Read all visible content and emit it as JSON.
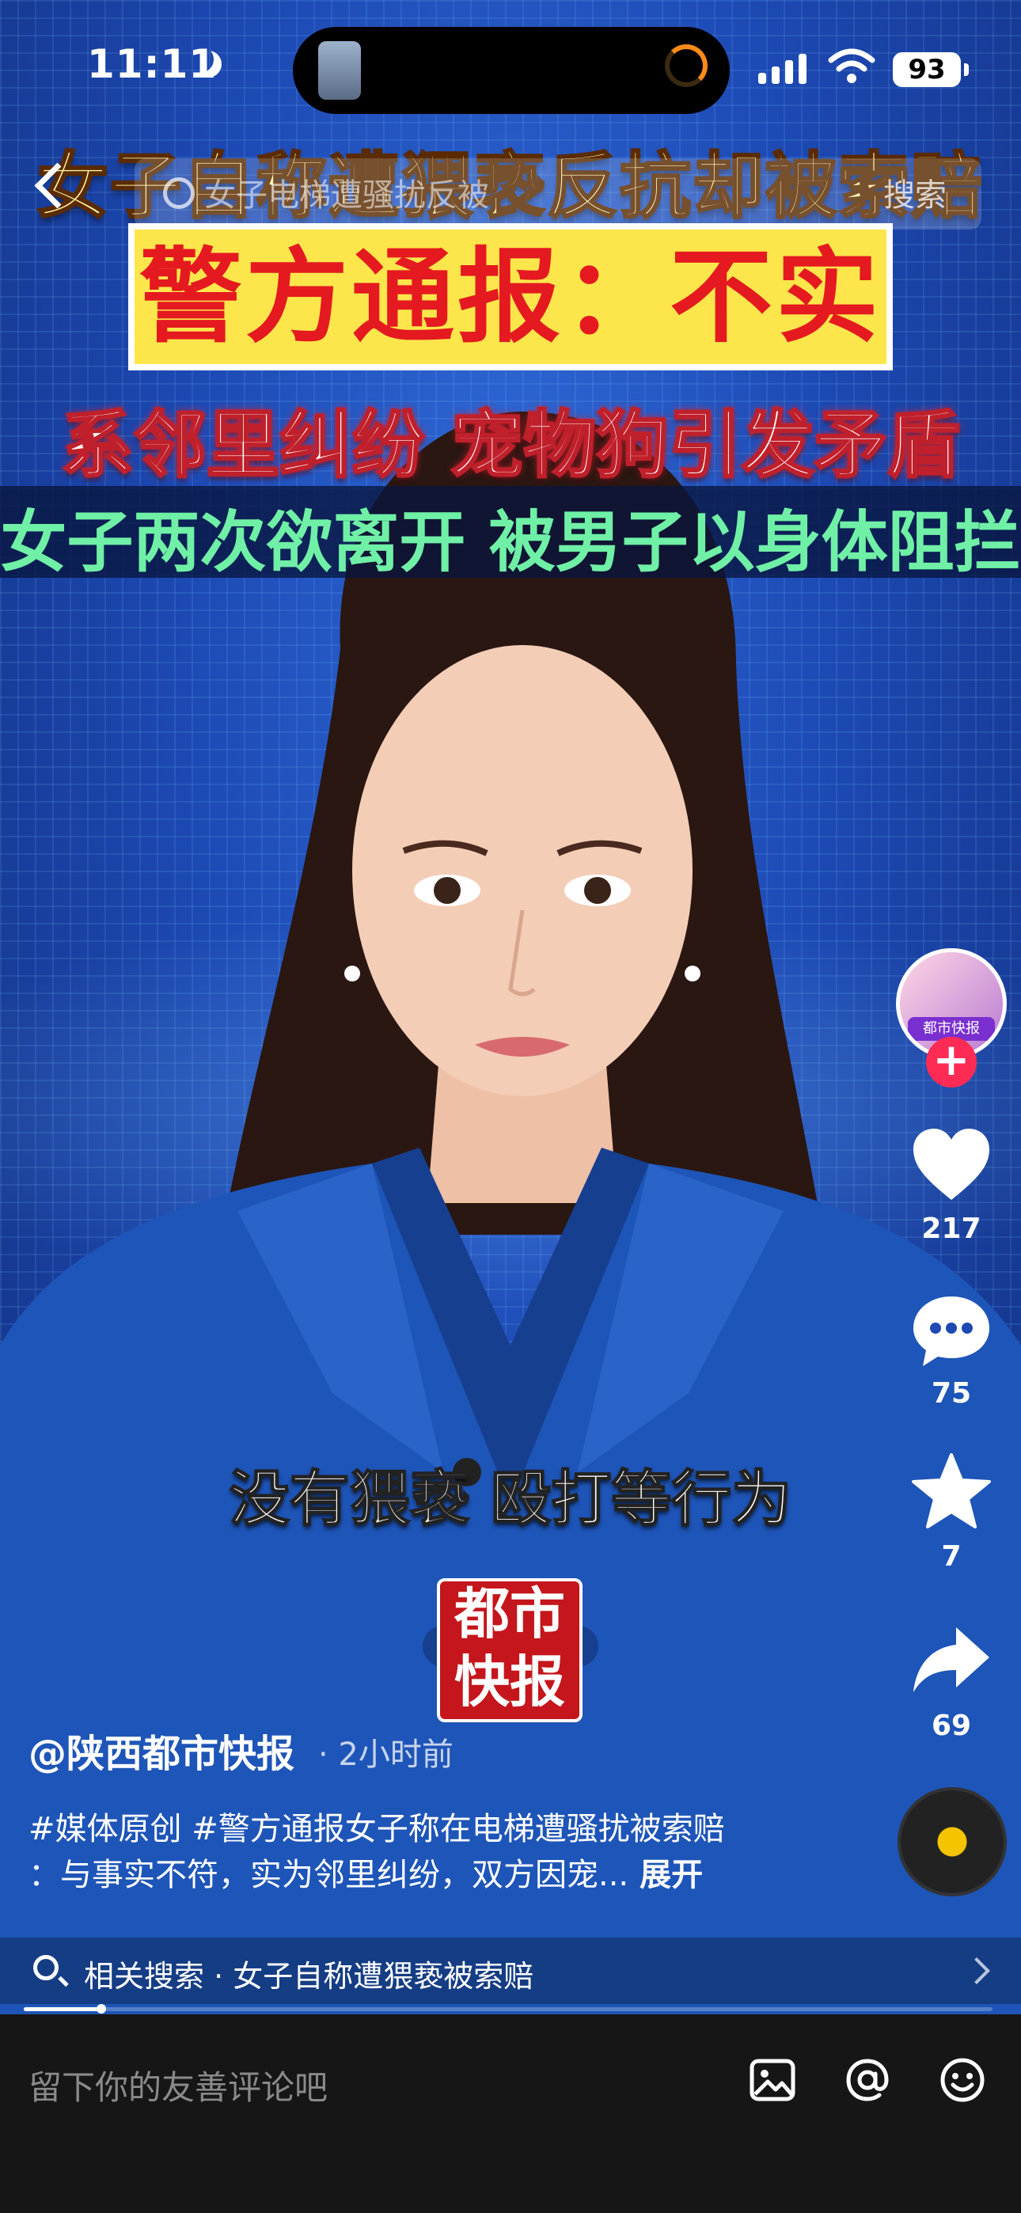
{
  "status_bar": {
    "time": "11:11",
    "battery": "93"
  },
  "top_search": {
    "placeholder": "女子电梯遭骚扰反被",
    "button": "搜索"
  },
  "overlay": {
    "headline_1": "女子自称遭猥亵反抗却被索赔",
    "headline_2": "警方通报：不实",
    "headline_3": "系邻里纠纷 宠物狗引发矛盾",
    "headline_4": "女子两次欲离开 被男子以身体阻拦",
    "subtitle": "没有猥亵 殴打等行为",
    "logo_line1": "都市",
    "logo_line2": "快报"
  },
  "rail": {
    "avatar_label": "都市快报",
    "likes": "217",
    "comments": "75",
    "favorites": "7",
    "shares": "69"
  },
  "caption": {
    "author": "@陕西都市快报",
    "time_ago": "· 2小时前",
    "line1": "#媒体原创 #警方通报女子称在电梯遭骚扰被索赔",
    "line2": "：与事实不符，实为邻里纠纷，双方因宠...",
    "expand": "展开"
  },
  "related_search": {
    "label": "相关搜索 · 女子自称遭猥亵被索赔"
  },
  "playback": {
    "progress_fraction": 0.08
  },
  "comment_bar": {
    "placeholder": "留下你的友善评论吧"
  },
  "colors": {
    "accent_red": "#fe2c55",
    "headline_green": "#6ff0a6",
    "police_yellow": "#fde64b"
  }
}
